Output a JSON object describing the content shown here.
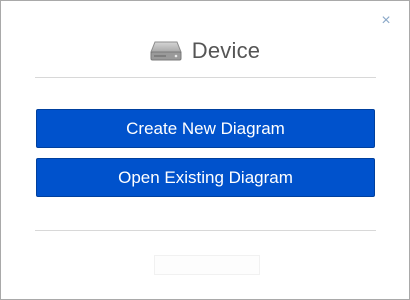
{
  "dialog": {
    "title": "Device",
    "close_glyph": "×",
    "icon": "hard-drive-icon",
    "buttons": {
      "create_label": "Create New Diagram",
      "open_label": "Open Existing Diagram"
    },
    "colors": {
      "button_bg": "#0052cc",
      "button_text": "#ffffff",
      "title_text": "#555555",
      "close": "#8aa8c8"
    }
  }
}
